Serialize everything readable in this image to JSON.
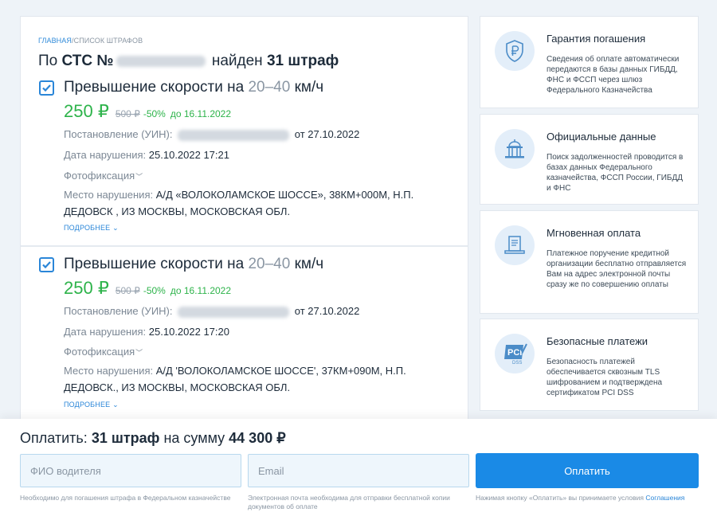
{
  "breadcrumb": {
    "home": "Главная",
    "separator": "/",
    "current": "Список штрафов"
  },
  "header": {
    "prefix": "По",
    "doc_type": "СТС №",
    "found": "найден",
    "count": "31 штраф"
  },
  "fines": [
    {
      "title_main": "Превышение скорости на",
      "title_range": "20–40",
      "title_unit": "км/ч",
      "price": "250 ₽",
      "old_price": "500 ₽",
      "discount": "-50%",
      "due": "до 16.11.2022",
      "resolution_label": "Постановление (УИН):",
      "resolution_date": "от 27.10.2022",
      "date_label": "Дата нарушения:",
      "date_value": "25.10.2022 17:21",
      "photo_label": "Фотофиксация",
      "place_label": "Место нарушения:",
      "place_value": "А/Д «ВОЛОКОЛАМСКОЕ ШОССЕ», 38КМ+000М, Н.П. ДЕДОВСК , ИЗ МОСКВЫ, МОСКОВСКАЯ ОБЛ.",
      "more": "Подробнее"
    },
    {
      "title_main": "Превышение скорости на",
      "title_range": "20–40",
      "title_unit": "км/ч",
      "price": "250 ₽",
      "old_price": "500 ₽",
      "discount": "-50%",
      "due": "до 16.11.2022",
      "resolution_label": "Постановление (УИН):",
      "resolution_date": "от 27.10.2022",
      "date_label": "Дата нарушения:",
      "date_value": "25.10.2022 17:20",
      "photo_label": "Фотофиксация",
      "place_label": "Место нарушения:",
      "place_value": "А/Д 'ВОЛОКОЛАМСКОЕ ШОССЕ', 37КМ+090М, Н.П. ДЕДОВСК., ИЗ МОСКВЫ, МОСКОВСКАЯ ОБЛ.",
      "more": "Подробнее"
    }
  ],
  "features": [
    {
      "icon": "ruble-shield-icon",
      "title": "Гарантия погашения",
      "text": "Сведения об оплате автоматически передаются в базы данных ГИБДД, ФНС и ФССП через шлюз Федерального Казначейства"
    },
    {
      "icon": "government-building-icon",
      "title": "Официальные данные",
      "text": "Поиск задолженностей проводится в базах данных Федерального казначейства, ФССП России, ГИБДД и ФНС"
    },
    {
      "icon": "payment-document-icon",
      "title": "Мгновенная оплата",
      "text": "Платежное поручение кредитной организации бесплатно отправляется Вам на адрес электронной почты сразу же по совершению оплаты"
    },
    {
      "icon": "pci-dss-icon",
      "title": "Безопасные платежи",
      "text": "Безопасность платежей обеспечивается сквозным TLS шифрованием и подтверждена сертификатом PCI DSS"
    }
  ],
  "payment": {
    "summary_prefix": "Оплатить:",
    "summary_count": "31 штраф",
    "summary_mid": "на сумму",
    "summary_amount": "44 300 ₽",
    "name_placeholder": "ФИО водителя",
    "email_placeholder": "Email",
    "button": "Оплатить",
    "name_hint": "Необходимо для погашения штрафа в Федеральном казначействе",
    "email_hint": "Электронная почта необходима для отправки бесплатной копии документов об оплате",
    "terms_hint": "Нажимая кнопку «Оплатить» вы принимаете условия",
    "terms_link": "Соглашения"
  },
  "colors": {
    "accent": "#1a8ae6",
    "price_green": "#2db34a",
    "background": "#eef3f8"
  }
}
